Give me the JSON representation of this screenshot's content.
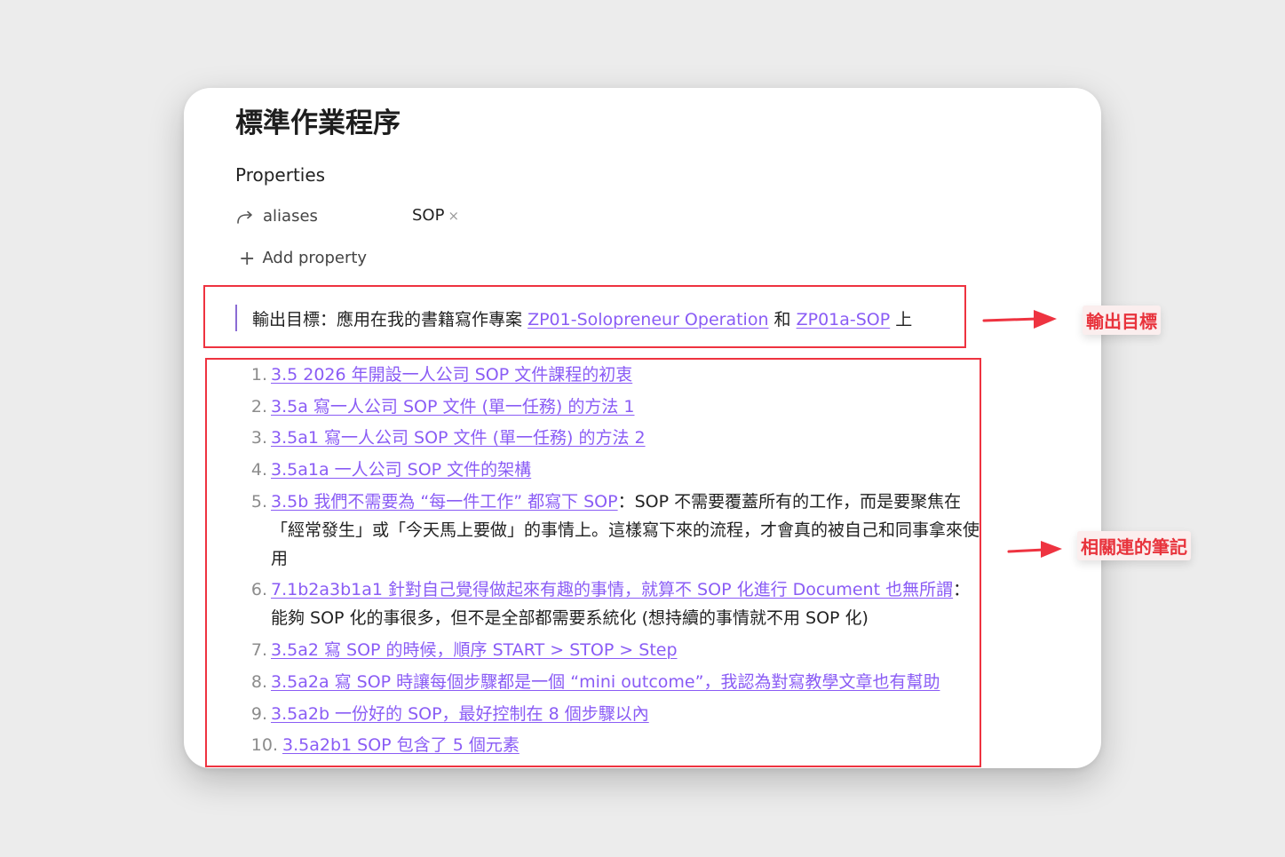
{
  "note": {
    "title": "標準作業程序",
    "properties_heading": "Properties",
    "property": {
      "icon": "forward-arrow-icon",
      "key": "aliases",
      "value": "SOP",
      "remove_glyph": "×"
    },
    "add_property_label": "Add property",
    "callout": {
      "prefix": "輸出目標：應用在我的書籍寫作專案",
      "link1": "ZP01-Solopreneur Operation",
      "conj": "和",
      "link2": "ZP01a-SOP",
      "suffix": "上"
    },
    "items": [
      {
        "num": "1.",
        "link": "3.5 2026 年開設一人公司 SOP 文件課程的初衷",
        "desc": ""
      },
      {
        "num": "2.",
        "link": "3.5a 寫一人公司 SOP 文件 (單一任務) 的方法 1",
        "desc": ""
      },
      {
        "num": "3.",
        "link": "3.5a1 寫一人公司 SOP 文件 (單一任務) 的方法 2",
        "desc": ""
      },
      {
        "num": "4.",
        "link": "3.5a1a 一人公司 SOP 文件的架構",
        "desc": ""
      },
      {
        "num": "5.",
        "link": "3.5b 我們不需要為 “每一件工作” 都寫下 SOP",
        "desc": "：SOP 不需要覆蓋所有的工作，而是要聚焦在「經常發生」或「今天馬上要做」的事情上。這樣寫下來的流程，才會真的被自己和同事拿來使用"
      },
      {
        "num": "6.",
        "link": "7.1b2a3b1a1 針對自己覺得做起來有趣的事情，就算不 SOP 化進行 Document 也無所謂",
        "desc": "：能夠 SOP 化的事很多，但不是全部都需要系統化 (想持續的事情就不用 SOP 化)"
      },
      {
        "num": "7.",
        "link": "3.5a2 寫 SOP 的時候，順序 START > STOP > Step",
        "desc": ""
      },
      {
        "num": "8.",
        "link": "3.5a2a 寫 SOP 時讓每個步驟都是一個 “mini outcome”，我認為對寫教學文章也有幫助",
        "desc": ""
      },
      {
        "num": "9.",
        "link": "3.5a2b 一份好的 SOP，最好控制在 8 個步驟以內",
        "desc": ""
      },
      {
        "num": "10.",
        "link": "3.5a2b1 SOP 包含了 5 個元素",
        "desc": ""
      }
    ]
  },
  "annotations": {
    "goal_label": "輸出目標",
    "related_label": "相關連的筆記",
    "color": "#ee3340"
  }
}
